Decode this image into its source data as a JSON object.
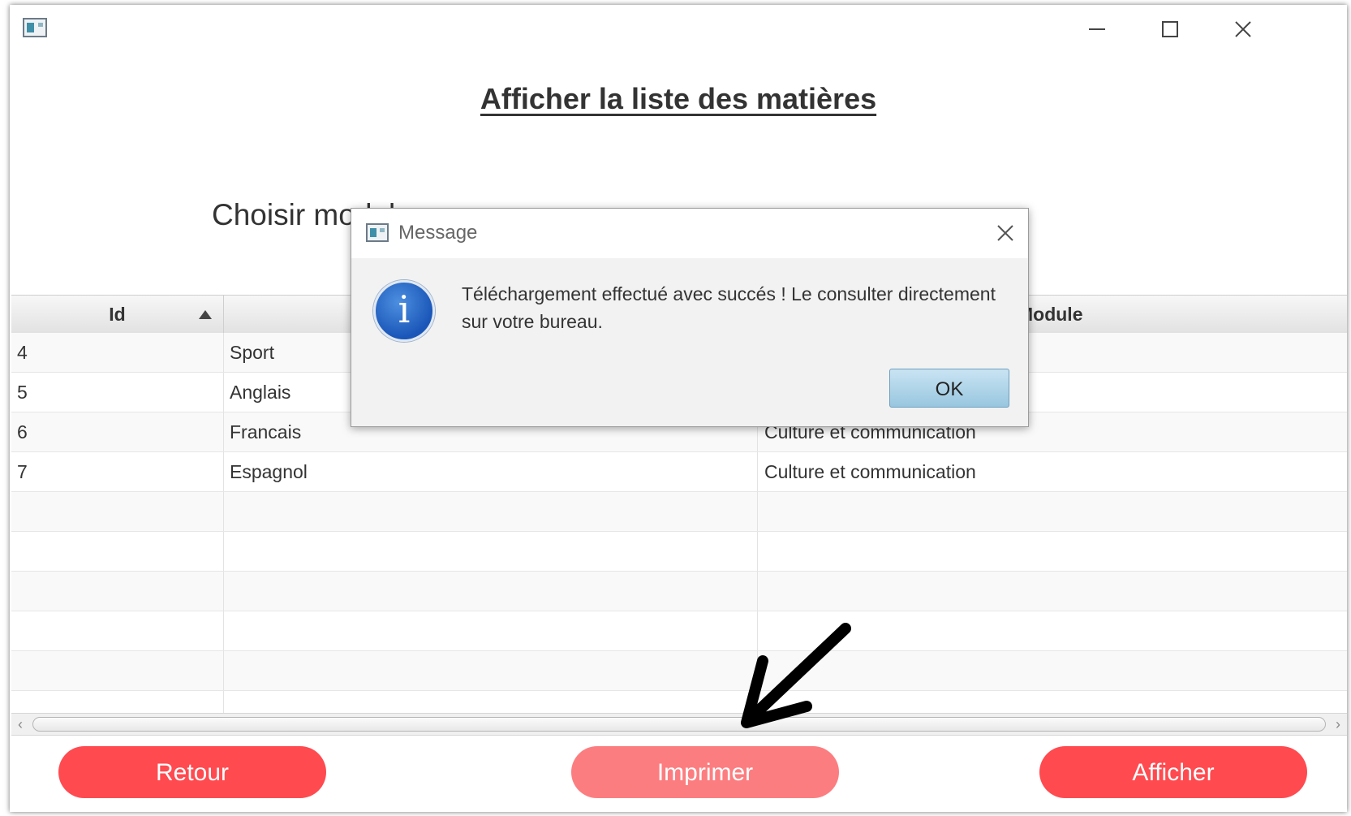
{
  "window": {
    "title": ""
  },
  "page": {
    "title": "Afficher la liste des matières",
    "filter_label": "Choisir module"
  },
  "table": {
    "columns": [
      "Id",
      "",
      "Module"
    ],
    "rows": [
      {
        "id": "4",
        "name": "Sport",
        "module": ""
      },
      {
        "id": "5",
        "name": "Anglais",
        "module": ""
      },
      {
        "id": "6",
        "name": "Francais",
        "module": "Culture et communication"
      },
      {
        "id": "7",
        "name": "Espagnol",
        "module": "Culture et communication"
      },
      {
        "id": "",
        "name": "",
        "module": ""
      },
      {
        "id": "",
        "name": "",
        "module": ""
      },
      {
        "id": "",
        "name": "",
        "module": ""
      },
      {
        "id": "",
        "name": "",
        "module": ""
      },
      {
        "id": "",
        "name": "",
        "module": ""
      },
      {
        "id": "",
        "name": "",
        "module": ""
      }
    ]
  },
  "buttons": {
    "retour": "Retour",
    "imprimer": "Imprimer",
    "afficher": "Afficher"
  },
  "dialog": {
    "title": "Message",
    "message": "Téléchargement effectué avec succés ! Le consulter directement sur votre bureau.",
    "ok_label": "OK",
    "icon": "info-icon"
  },
  "colors": {
    "primary_button": "#ff4a4f",
    "pressed_button": "#fc7d80",
    "ok_button": "#a8d1e8"
  }
}
